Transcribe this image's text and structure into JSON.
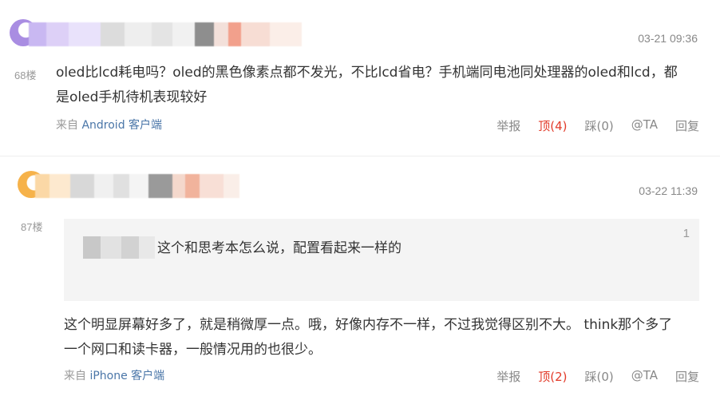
{
  "posts": [
    {
      "time": "03-21 09:36",
      "floor": "68楼",
      "content_line1": "oled比lcd耗电吗？oled的黑色像素点都不发光，不比lcd省电？手机端同电池同处理器的oled和lcd，都",
      "content_line2": "是oled手机待机表现较好",
      "source_prefix": "来自",
      "source_device": "Android 客户端",
      "actions": {
        "report": "举报",
        "up": "顶(4)",
        "down": "踩(0)",
        "at": "@TA",
        "reply": "回复"
      }
    },
    {
      "time": "03-22 11:39",
      "floor": "87楼",
      "quote": {
        "number": "1",
        "text": "这个和思考本怎么说，配置看起来一样的"
      },
      "content_line1": "这个明显屏幕好多了，就是稍微厚一点。哦，好像内存不一样，不过我觉得区别不大。 think那个多了",
      "content_line2": "一个网口和读卡器，一般情况用的也很少。",
      "source_prefix": "来自",
      "source_device": "iPhone 客户端",
      "actions": {
        "report": "举报",
        "up": "顶(2)",
        "down": "踩(0)",
        "at": "@TA",
        "reply": "回复"
      }
    }
  ],
  "colors": {
    "upvote": "#e23b2a",
    "link": "#4a76a8",
    "quote_bg": "#f4f4f4"
  },
  "icons": [
    "avatar-purple",
    "avatar-orange"
  ]
}
